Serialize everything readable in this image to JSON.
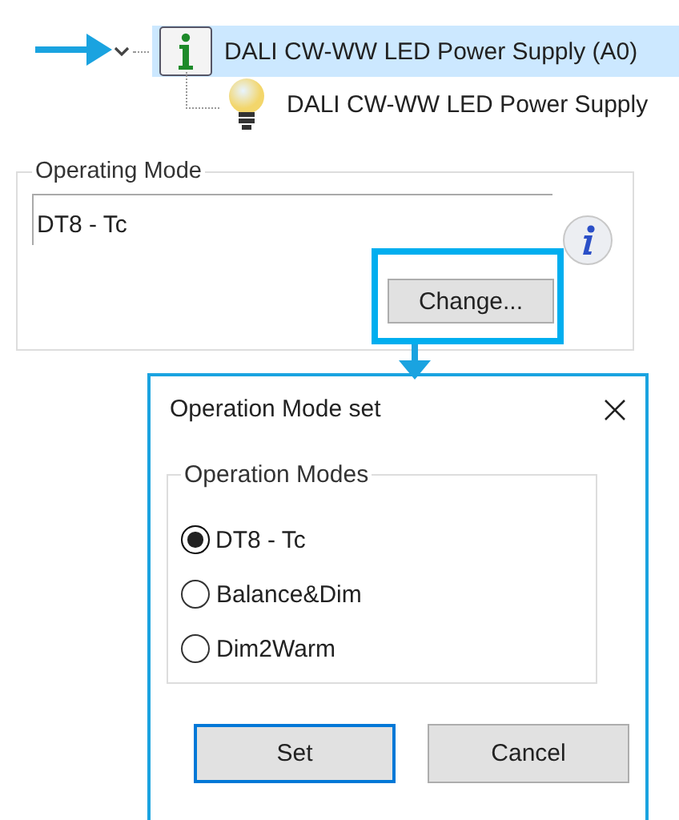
{
  "tree": [
    {
      "kind": "info",
      "label": "DALI CW-WW LED Power Supply (A0)",
      "selected": true,
      "expanded": true,
      "children": [
        {
          "kind": "bulb",
          "label": "DALI CW-WW LED Power Supply",
          "selected": false
        }
      ]
    }
  ],
  "operating_mode": {
    "title": "Operating Mode",
    "value": "DT8 - Tc",
    "button": "Change..."
  },
  "dialog": {
    "title": "Operation Mode set",
    "group_title": "Operation Modes",
    "options": [
      {
        "label": "DT8 - Tc",
        "selected": true
      },
      {
        "label": "Balance&Dim",
        "selected": false
      },
      {
        "label": "Dim2Warm",
        "selected": false
      }
    ],
    "buttons": [
      {
        "label": "Set",
        "default": true
      },
      {
        "label": "Cancel",
        "default": false
      }
    ]
  }
}
